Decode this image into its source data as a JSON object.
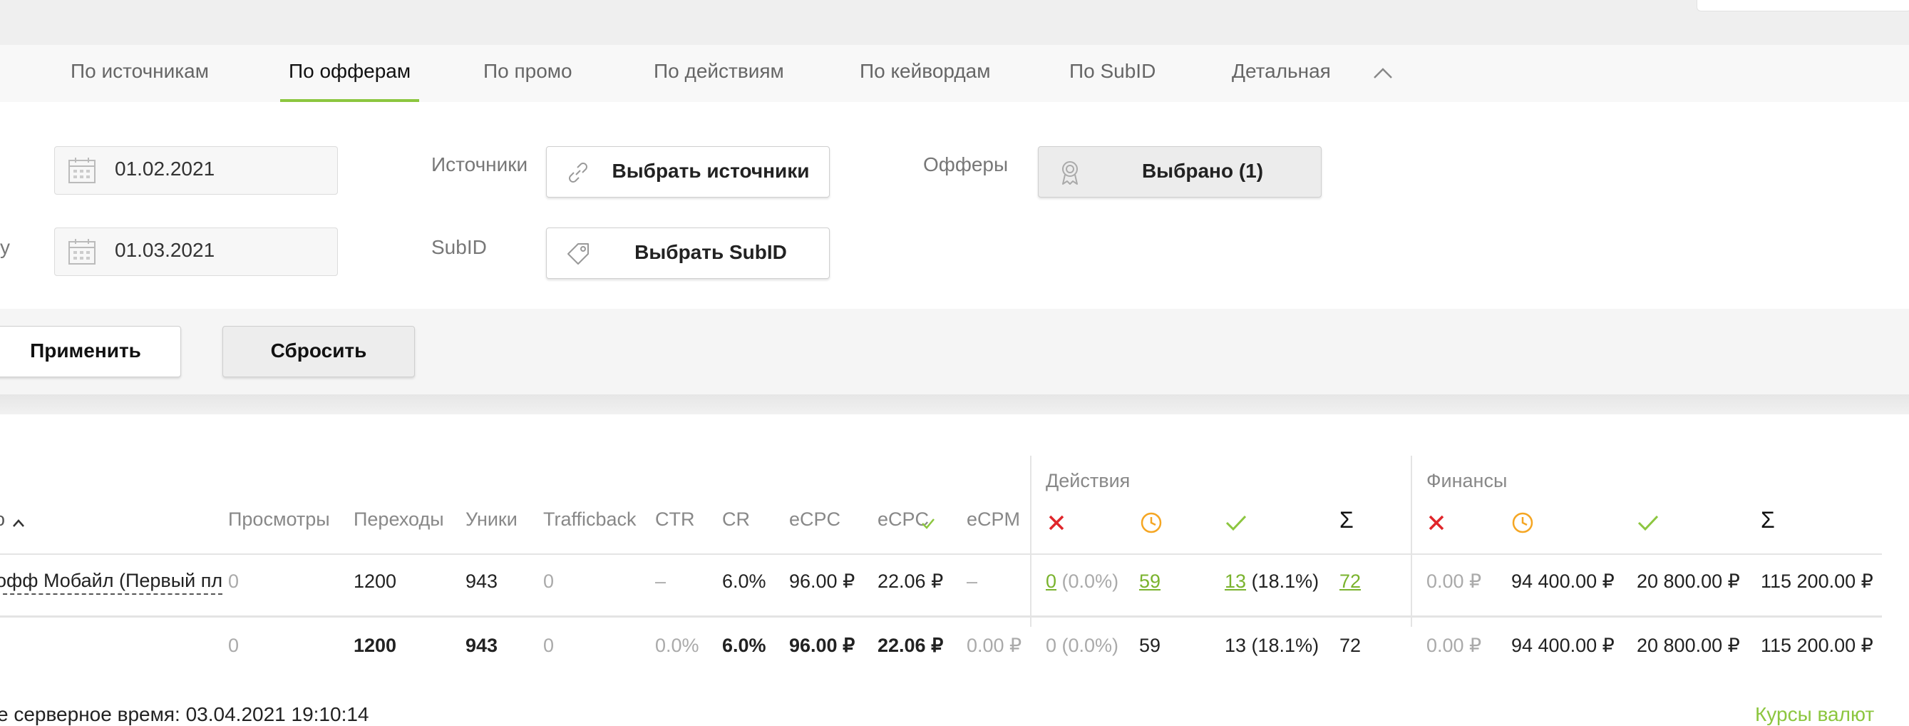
{
  "tabs": [
    {
      "label": "По источникам"
    },
    {
      "label": "По офферам",
      "active": true
    },
    {
      "label": "По промо"
    },
    {
      "label": "По действиям"
    },
    {
      "label": "По кейвордам"
    },
    {
      "label": "По SubID"
    },
    {
      "label": "Детальная"
    }
  ],
  "filters": {
    "date_from": "01.02.2021",
    "date_to": "01.03.2021",
    "date_to_label_tail": "у",
    "sources_label": "Источники",
    "sources_button": "Выбрать источники",
    "subid_label": "SubID",
    "subid_button": "Выбрать SubID",
    "offers_label": "Офферы",
    "offers_button": "Выбрано (1)",
    "apply_button": "Применить",
    "reset_button": "Сбросить"
  },
  "table": {
    "offer_header_fragment": "о",
    "headers": {
      "views": "Просмотры",
      "clicks": "Переходы",
      "uniques": "Уники",
      "trafficback": "Trafficback",
      "ctr": "CTR",
      "cr": "CR",
      "ecpc": "eCPC",
      "ecpc_approved": "eCPC",
      "ecpm": "eCPM",
      "actions_group": "Действия",
      "finance_group": "Финансы",
      "sum_symbol": "Σ"
    },
    "row": {
      "offer": "офф Мобайл (Первый пл",
      "views": "0",
      "clicks": "1200",
      "uniques": "943",
      "trafficback": "0",
      "ctr": "–",
      "cr": "6.0%",
      "ecpc": "96.00 ₽",
      "ecpc_approved": "22.06 ₽",
      "ecpm": "–",
      "act_rejected_count": "0",
      "act_rejected_pct": "(0.0%)",
      "act_pending": "59",
      "act_approved_count": "13",
      "act_approved_pct": "(18.1%)",
      "act_total": "72",
      "fin_rejected": "0.00 ₽",
      "fin_pending": "94 400.00 ₽",
      "fin_approved": "20 800.00 ₽",
      "fin_total": "115 200.00 ₽"
    },
    "totals": {
      "views": "0",
      "clicks": "1200",
      "uniques": "943",
      "trafficback": "0",
      "ctr": "0.0%",
      "cr": "6.0%",
      "ecpc": "96.00 ₽",
      "ecpc_approved": "22.06 ₽",
      "ecpm": "0.00 ₽",
      "act_rejected": "0 (0.0%)",
      "act_pending": "59",
      "act_approved": "13 (18.1%)",
      "act_total": "72",
      "fin_rejected": "0.00 ₽",
      "fin_pending": "94 400.00 ₽",
      "fin_approved": "20 800.00 ₽",
      "fin_total": "115 200.00 ₽"
    }
  },
  "footer": {
    "server_time_label": "е серверное время:",
    "server_time": "03.04.2021 19:10:14",
    "currency_rates": "Курсы валют"
  },
  "colors": {
    "accent": "#8cc63f",
    "link": "#7ab32e",
    "rejected": "#e0262b",
    "pending": "#f5a623",
    "approved": "#8cc63f"
  }
}
